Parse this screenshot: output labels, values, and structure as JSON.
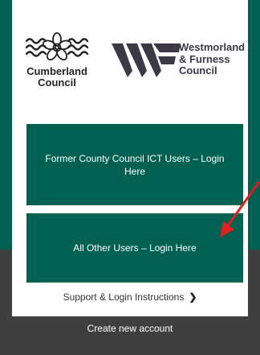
{
  "logos": {
    "cumberland": {
      "line1": "Cumberland",
      "line2": "Council"
    },
    "westmorland": {
      "line1": "Westmorland",
      "line2": "& Furness",
      "line3": "Council"
    }
  },
  "login": {
    "ict_button_label": "Former County Council ICT Users – Login Here",
    "other_button_label": "All Other Users – Login Here"
  },
  "support": {
    "label": "Support & Login Instructions",
    "icon": "chevron-right-icon"
  },
  "footer": {
    "create_account_label": "Create new account"
  },
  "colors": {
    "brand_green": "#006152",
    "background_dark": "#3f3f3f",
    "annotation_arrow": "#e0201f",
    "westmorland_logo": "#3d3845"
  }
}
